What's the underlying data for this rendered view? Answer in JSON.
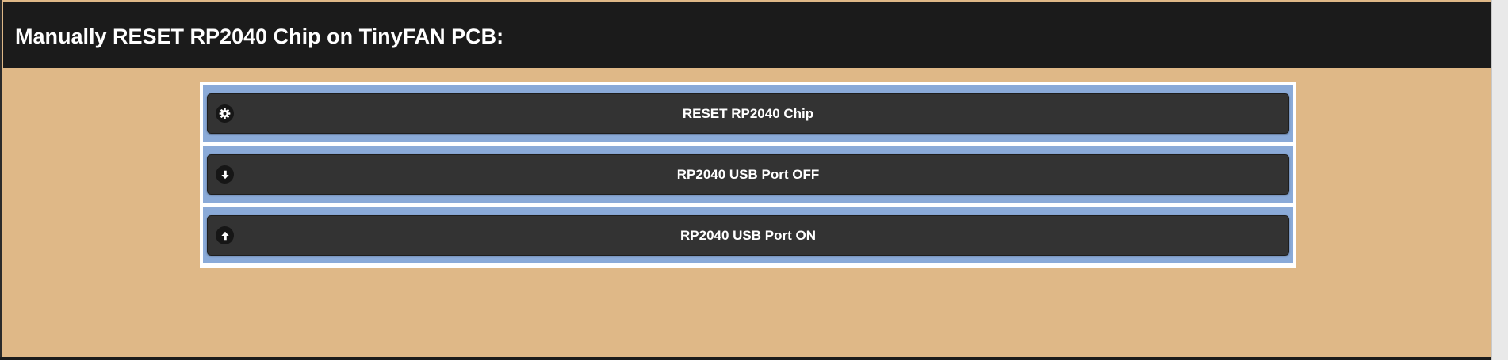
{
  "header": {
    "title": "Manually RESET RP2040 Chip on TinyFAN PCB:"
  },
  "buttons": [
    {
      "label": "RESET RP2040 Chip",
      "icon": "gear-icon"
    },
    {
      "label": "RP2040 USB Port OFF",
      "icon": "arrow-down-icon"
    },
    {
      "label": "RP2040 USB Port ON",
      "icon": "arrow-up-icon"
    }
  ],
  "colors": {
    "background": "#dfb887",
    "header": "#1b1b1b",
    "row": "#8aaad8",
    "button": "#333333"
  }
}
